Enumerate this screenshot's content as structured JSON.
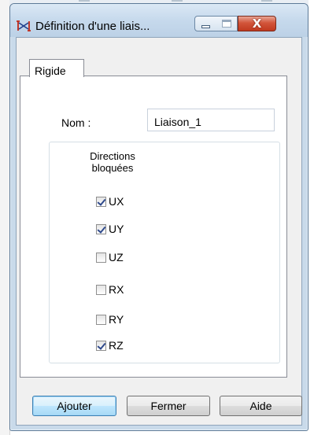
{
  "window": {
    "title": "Définition d'une liais...",
    "controls": {
      "minimize": "minimize",
      "maximize": "maximize",
      "close": "X"
    }
  },
  "tabs": [
    {
      "label": "Rigide",
      "active": true
    }
  ],
  "form": {
    "name_label": "Nom :",
    "name_value": "Liaison_1",
    "group_title_line1": "Directions",
    "group_title_line2": "bloquées",
    "checks": [
      {
        "label": "UX",
        "checked": true
      },
      {
        "label": "UY",
        "checked": true
      },
      {
        "label": "UZ",
        "checked": false
      },
      {
        "label": "RX",
        "checked": false
      },
      {
        "label": "RY",
        "checked": false
      },
      {
        "label": "RZ",
        "checked": true
      }
    ]
  },
  "buttons": {
    "add": "Ajouter",
    "close": "Fermer",
    "help": "Aide"
  },
  "colors": {
    "titlebar": "#c6d9ec",
    "close_button": "#c0391f",
    "check_mark": "#2f4a8c"
  }
}
